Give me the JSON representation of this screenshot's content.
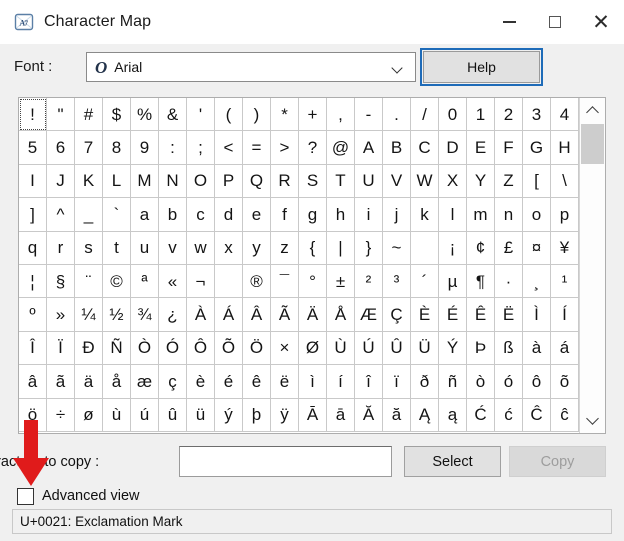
{
  "window": {
    "title": "Character Map",
    "icon": "character-map-icon",
    "minimize_label": "–",
    "maximize_label": "□",
    "close_label": "✕"
  },
  "font_row": {
    "label": "Font :",
    "font_icon": "O",
    "selected_font": "Arial",
    "dropdown_icon": "chevron-down-icon",
    "help_label": "Help"
  },
  "grid": {
    "selected_index": 0,
    "columns": 20,
    "characters": [
      "!",
      "\"",
      "#",
      "$",
      "%",
      "&",
      "'",
      "(",
      ")",
      "*",
      "+",
      ",",
      "-",
      ".",
      "/",
      "0",
      "1",
      "2",
      "3",
      "4",
      "5",
      "6",
      "7",
      "8",
      "9",
      ":",
      ";",
      "<",
      "=",
      ">",
      "?",
      "@",
      "A",
      "B",
      "C",
      "D",
      "E",
      "F",
      "G",
      "H",
      "I",
      "J",
      "K",
      "L",
      "M",
      "N",
      "O",
      "P",
      "Q",
      "R",
      "S",
      "T",
      "U",
      "V",
      "W",
      "X",
      "Y",
      "Z",
      "[",
      "\\",
      "]",
      "^",
      "_",
      "`",
      "a",
      "b",
      "c",
      "d",
      "e",
      "f",
      "g",
      "h",
      "i",
      "j",
      "k",
      "l",
      "m",
      "n",
      "o",
      "p",
      "q",
      "r",
      "s",
      "t",
      "u",
      "v",
      "w",
      "x",
      "y",
      "z",
      "{",
      "|",
      "}",
      "~",
      "",
      "¡",
      "¢",
      "£",
      "¤",
      "¥",
      "¦",
      "§",
      "¨",
      "©",
      "ª",
      "«",
      "¬",
      "­",
      "®",
      "¯",
      "°",
      "±",
      "²",
      "³",
      "´",
      "µ",
      "¶",
      "·",
      "¸",
      "¹",
      "º",
      "»",
      "¼",
      "½",
      "¾",
      "¿",
      "À",
      "Á",
      "Â",
      "Ã",
      "Ä",
      "Å",
      "Æ",
      "Ç",
      "È",
      "É",
      "Ê",
      "Ë",
      "Ì",
      "Í",
      "Î",
      "Ï",
      "Ð",
      "Ñ",
      "Ò",
      "Ó",
      "Ô",
      "Õ",
      "Ö",
      "×",
      "Ø",
      "Ù",
      "Ú",
      "Û",
      "Ü",
      "Ý",
      "Þ",
      "ß",
      "à",
      "á",
      "â",
      "ã",
      "ä",
      "å",
      "æ",
      "ç",
      "è",
      "é",
      "ê",
      "ë",
      "ì",
      "í",
      "î",
      "ï",
      "ð",
      "ñ",
      "ò",
      "ó",
      "ô",
      "õ",
      "ö",
      "÷",
      "ø",
      "ù",
      "ú",
      "û",
      "ü",
      "ý",
      "þ",
      "ÿ",
      "Ā",
      "ā",
      "Ă",
      "ă",
      "Ą",
      "ą",
      "Ć",
      "ć",
      "Ĉ",
      "ĉ"
    ]
  },
  "scrollbar": {
    "up_icon": "chevron-up-icon",
    "down_icon": "chevron-down-icon"
  },
  "copy_row": {
    "label": "aracters to copy :",
    "input_value": "",
    "input_placeholder": "",
    "select_label": "Select",
    "copy_label": "Copy",
    "copy_enabled": false
  },
  "advanced": {
    "label": "Advanced view",
    "checked": false
  },
  "status": {
    "text": "U+0021: Exclamation Mark"
  },
  "annotation": {
    "arrow_color": "#e01b1b",
    "points_to": "advanced-view-checkbox"
  }
}
